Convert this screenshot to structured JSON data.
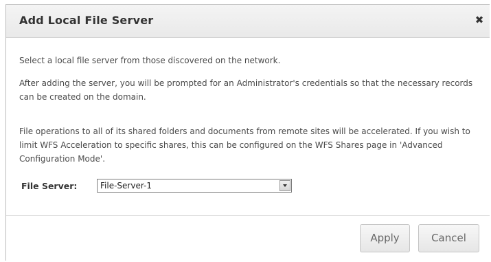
{
  "dialog": {
    "title": "Add Local File Server",
    "close_icon": "close-icon",
    "close_glyph": "✖",
    "paragraphs": [
      "Select a local file server from those discovered on the network.",
      "After adding the server, you will be prompted for an Administrator's credentials so that the necessary records can be created on the domain.",
      "File operations to all of its shared folders and documents from remote sites will be accelerated. If you wish to limit WFS Acceleration to specific shares, this can be configured on the WFS Shares page in 'Advanced Configuration Mode'."
    ],
    "file_server": {
      "label": "File Server:",
      "selected": "File-Server-1",
      "arrow_icon": "chevron-down-icon"
    },
    "buttons": {
      "apply": "Apply",
      "cancel": "Cancel"
    }
  }
}
